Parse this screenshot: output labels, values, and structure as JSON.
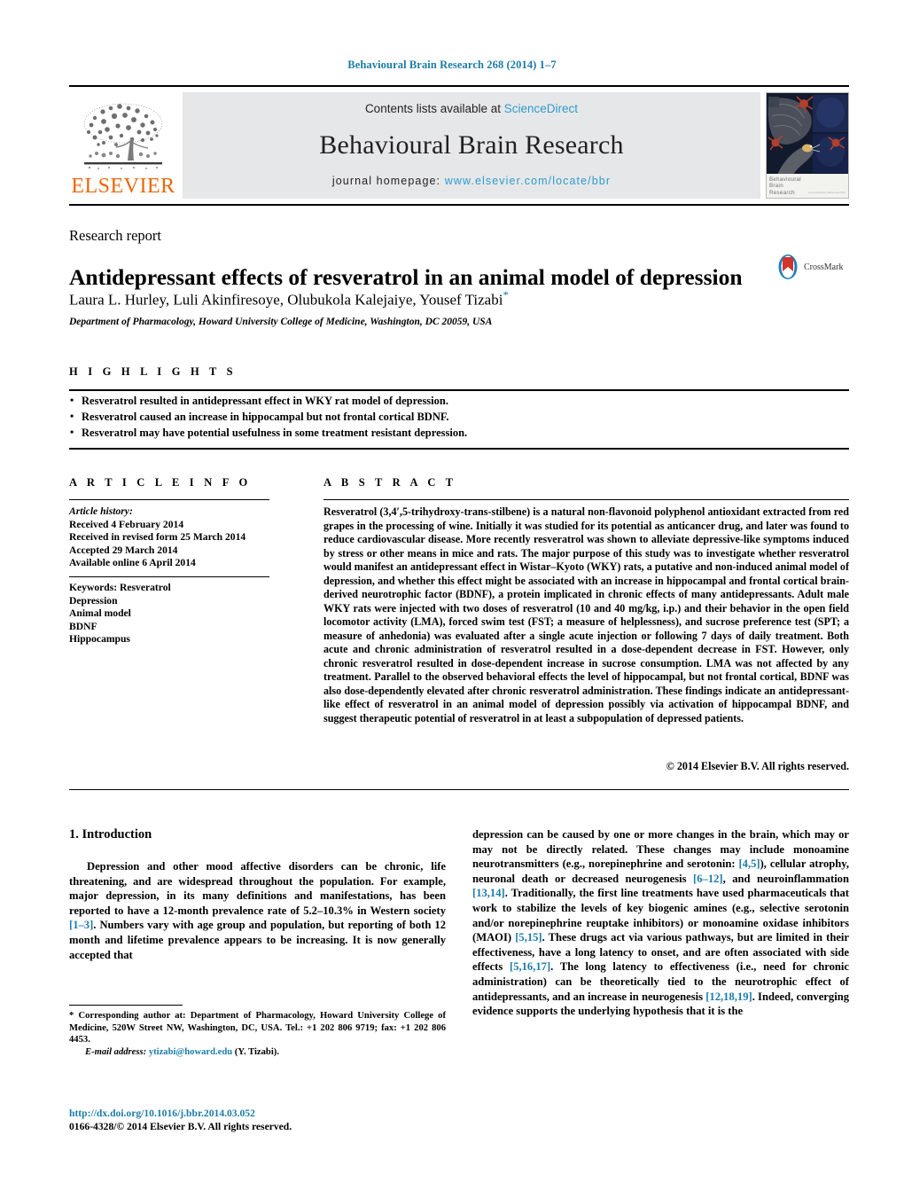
{
  "running_head": "Behavioural Brain Research 268 (2014) 1–7",
  "masthead": {
    "contents_prefix": "Contents lists available at ",
    "sciencedirect": "ScienceDirect",
    "journal_name": "Behavioural Brain Research",
    "homepage_prefix": "journal homepage:",
    "homepage_url": "www.elsevier.com/locate/bbr",
    "publisher_logo_text": "ELSEVIER",
    "cover_caption_line1": "Behavioural",
    "cover_caption_line2": "Brain",
    "cover_caption_line3": "Research",
    "cover_tiny_text": "www.elsevier.com/locate/bbr"
  },
  "article": {
    "type": "Research report",
    "title": "Antidepressant effects of resveratrol in an animal model of depression",
    "crossmark_label": "CrossMark",
    "authors": "Laura L. Hurley, Luli Akinfiresoye, Olubukola Kalejaiye, Yousef Tizabi",
    "affiliation": "Department of Pharmacology, Howard University College of Medicine, Washington, DC 20059, USA"
  },
  "highlights": {
    "heading": "HIGHLIGHTS",
    "items": [
      "Resveratrol resulted in antidepressant effect in WKY rat model of depression.",
      "Resveratrol caused an increase in hippocampal but not frontal cortical BDNF.",
      "Resveratrol may have potential usefulness in some treatment resistant depression."
    ]
  },
  "article_info": {
    "heading": "ARTICLE INFO",
    "history_label": "Article history:",
    "history": [
      "Received 4 February 2014",
      "Received in revised form 25 March 2014",
      "Accepted 29 March 2014",
      "Available online 6 April 2014"
    ],
    "keywords_label": "Keywords:",
    "keywords": [
      "Resveratrol",
      "Depression",
      "Animal model",
      "BDNF",
      "Hippocampus"
    ]
  },
  "abstract": {
    "heading": "ABSTRACT",
    "text": "Resveratrol (3,4′,5-trihydroxy-trans-stilbene) is a natural non-flavonoid polyphenol antioxidant extracted from red grapes in the processing of wine. Initially it was studied for its potential as anticancer drug, and later was found to reduce cardiovascular disease. More recently resveratrol was shown to alleviate depressive-like symptoms induced by stress or other means in mice and rats. The major purpose of this study was to investigate whether resveratrol would manifest an antidepressant effect in Wistar–Kyoto (WKY) rats, a putative and non-induced animal model of depression, and whether this effect might be associated with an increase in hippocampal and frontal cortical brain-derived neurotrophic factor (BDNF), a protein implicated in chronic effects of many antidepressants. Adult male WKY rats were injected with two doses of resveratrol (10 and 40 mg/kg, i.p.) and their behavior in the open field locomotor activity (LMA), forced swim test (FST; a measure of helplessness), and sucrose preference test (SPT; a measure of anhedonia) was evaluated after a single acute injection or following 7 days of daily treatment. Both acute and chronic administration of resveratrol resulted in a dose-dependent decrease in FST. However, only chronic resveratrol resulted in dose-dependent increase in sucrose consumption. LMA was not affected by any treatment. Parallel to the observed behavioral effects the level of hippocampal, but not frontal cortical, BDNF was also dose-dependently elevated after chronic resveratrol administration. These findings indicate an antidepressant-like effect of resveratrol in an animal model of depression possibly via activation of hippocampal BDNF, and suggest therapeutic potential of resveratrol in at least a subpopulation of depressed patients.",
    "copyright": "© 2014 Elsevier B.V. All rights reserved."
  },
  "introduction": {
    "heading": "1. Introduction",
    "left_paragraph_1": "Depression and other mood affective disorders can be chronic, life threatening, and are widespread throughout the population. For example, major depression, in its many definitions and manifestations, has been reported to have a 12-month prevalence rate of 5.2–10.3% in Western society ",
    "left_ref_1": "[1–3]",
    "left_paragraph_1b": ". Numbers vary with age group and population, but reporting of both 12 month and lifetime prevalence appears to be increasing. It is now generally accepted that",
    "right_seg_1": "depression can be caused by one or more changes in the brain, which may or may not be directly related. These changes may include monoamine neurotransmitters (e.g., norepinephrine and serotonin: ",
    "right_ref_1": "[4,5]",
    "right_seg_2": "), cellular atrophy, neuronal death or decreased neurogenesis ",
    "right_ref_2": "[6–12]",
    "right_seg_3": ", and neuroinflammation ",
    "right_ref_3": "[13,14]",
    "right_seg_4": ". Traditionally, the first line treatments have used pharmaceuticals that work to stabilize the levels of key biogenic amines (e.g., selective serotonin and/or norepinephrine reuptake inhibitors) or monoamine oxidase inhibitors (MAOI) ",
    "right_ref_4": "[5,15]",
    "right_seg_5": ". These drugs act via various pathways, but are limited in their effectiveness, have a long latency to onset, and are often associated with side effects ",
    "right_ref_5": "[5,16,17]",
    "right_seg_6": ". The long latency to effectiveness (i.e., need for chronic administration) can be theoretically tied to the neurotrophic effect of antidepressants, and an increase in neurogenesis ",
    "right_ref_6": "[12,18,19]",
    "right_seg_7": ". Indeed, converging evidence supports the underlying hypothesis that it is the"
  },
  "footnote": {
    "corresponding": "* Corresponding author at: Department of Pharmacology, Howard University College of Medicine, 520W Street NW, Washington, DC, USA. Tel.: +1 202 806 9719; fax: +1 202 806 4453.",
    "email_label": "E-mail address:",
    "email": "ytizabi@howard.edu",
    "email_suffix": "(Y. Tizabi).",
    "doi": "http://dx.doi.org/10.1016/j.bbr.2014.03.052",
    "issn_line": "0166-4328/© 2014 Elsevier B.V. All rights reserved."
  },
  "colors": {
    "link": "#1b7ca8",
    "sciencedirect": "#2d9ccc",
    "elsevier_orange": "#ec6608",
    "masthead_bg": "#e6e7e8"
  }
}
